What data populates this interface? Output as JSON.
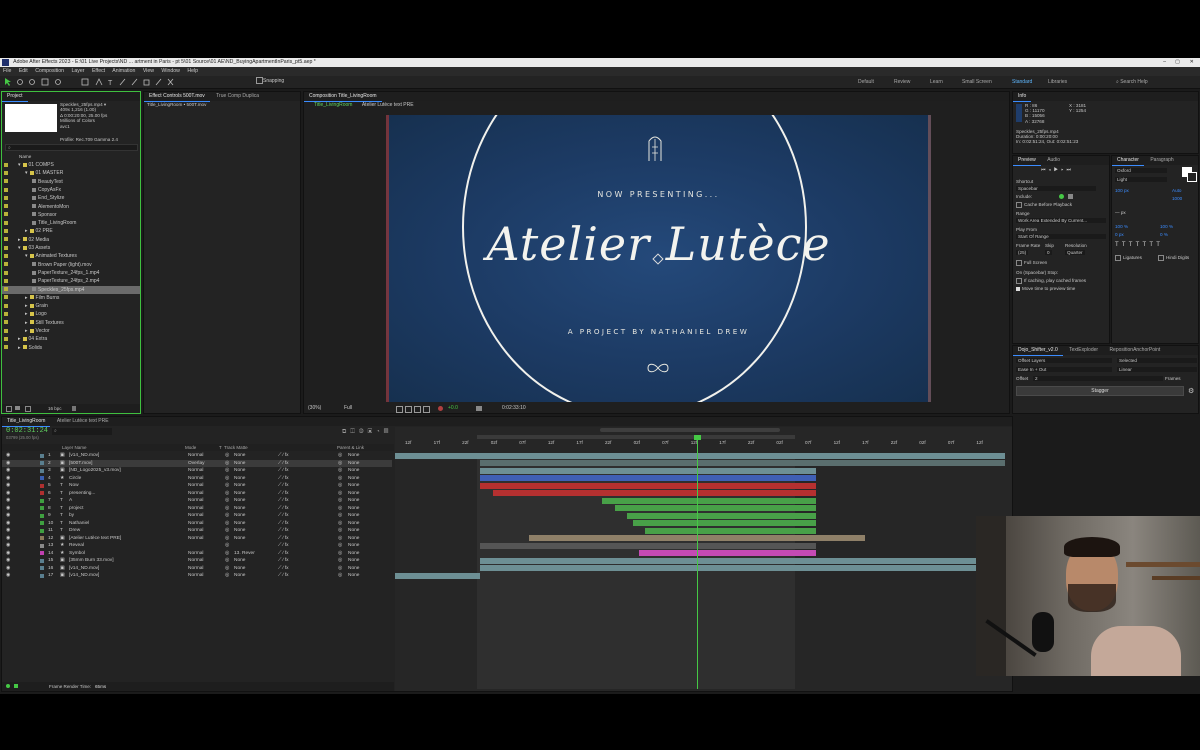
{
  "window": {
    "title": "Adobe After Effects 2023 - E:\\01 Live Projects\\ND ... artment in Paris - pt 5\\01 Source\\01 AE\\ND_BuyingApartmentInParis_pt5.aep *",
    "min": "–",
    "max": "▢",
    "close": "✕"
  },
  "menu": [
    "File",
    "Edit",
    "Composition",
    "Layer",
    "Effect",
    "Animation",
    "View",
    "Window",
    "Help"
  ],
  "toolbar": {
    "snapping_label": "Snapping",
    "workspaces": [
      "Default",
      "Review",
      "Learn",
      "Small Screen",
      "Standard",
      "Libraries"
    ],
    "active_workspace": "Standard",
    "search_placeholder": "Search Help"
  },
  "project": {
    "tab": "Project",
    "footage_info": {
      "name": "Speckles_25fps.mp4 ▾",
      "res": "409x 1,216 (1.00)",
      "duration": "Δ 0:00:20:00, 25.00 fps",
      "colors": "Millions of Colors",
      "codec": "avc1",
      "profile": "Profile: Rec.709 Gamma 2.4"
    },
    "search_placeholder": "⌕",
    "name_header": "Name",
    "tree": [
      {
        "label": "01 COMPS",
        "indent": 0,
        "color": "#d6c44a",
        "open": true
      },
      {
        "label": "01 MASTER",
        "indent": 1,
        "color": "#d6c44a",
        "open": true
      },
      {
        "label": "BeautyText",
        "indent": 2,
        "color": "#8a8a8a"
      },
      {
        "label": "CopyAsFx",
        "indent": 2,
        "color": "#8a8a8a"
      },
      {
        "label": "End_Stylize",
        "indent": 2,
        "color": "#8a8a8a"
      },
      {
        "label": "AlementoMon",
        "indent": 2,
        "color": "#8a8a8a"
      },
      {
        "label": "Sponsor",
        "indent": 2,
        "color": "#8a8a8a"
      },
      {
        "label": "Title_LivingRoom",
        "indent": 2,
        "color": "#8a8a8a"
      },
      {
        "label": "02 PRE",
        "indent": 1,
        "color": "#d6c44a"
      },
      {
        "label": "02 Media",
        "indent": 0,
        "color": "#d6c44a"
      },
      {
        "label": "03 Assets",
        "indent": 0,
        "color": "#d6c44a",
        "open": true
      },
      {
        "label": "Animated Textures",
        "indent": 1,
        "color": "#d6c44a",
        "open": true
      },
      {
        "label": "Brown Paper (light).mov",
        "indent": 2,
        "color": "#8a8a8a"
      },
      {
        "label": "PaperTexture_24fps_1.mp4",
        "indent": 2,
        "color": "#8a8a8a"
      },
      {
        "label": "PaperTexture_24fps_2.mp4",
        "indent": 2,
        "color": "#8a8a8a"
      },
      {
        "label": "Speckles_25fps.mp4",
        "indent": 2,
        "color": "#8a8a8a",
        "selected": true
      },
      {
        "label": "Film Burns",
        "indent": 1,
        "color": "#d6c44a"
      },
      {
        "label": "Grain",
        "indent": 1,
        "color": "#d6c44a"
      },
      {
        "label": "Logo",
        "indent": 1,
        "color": "#d6c44a"
      },
      {
        "label": "Still Textures",
        "indent": 1,
        "color": "#d6c44a"
      },
      {
        "label": "Vector",
        "indent": 1,
        "color": "#d6c44a"
      },
      {
        "label": "04 Extra",
        "indent": 0,
        "color": "#d6c44a"
      },
      {
        "label": "Solids",
        "indent": 0,
        "color": "#d6c44a"
      }
    ],
    "bpc": "16 bpc"
  },
  "effect_controls": {
    "tabs": [
      "Effect Controls 500T.mov",
      "True Comp Duplica"
    ],
    "subtitle": "Title_LivingRoom • 500T.mov"
  },
  "composition": {
    "tab": "Composition Title_LivingRoom",
    "sub_tabs": [
      "Title_LivingRoom",
      "Atelier Lutèce text PRE"
    ],
    "canvas": {
      "now_presenting": "NOW PRESENTING...",
      "title": "Atelier Lutèce",
      "byline": "A PROJECT BY NATHANIEL DREW"
    },
    "footer": {
      "zoom": "(30%)",
      "res": "Full",
      "exposure": "+0.0",
      "time": "0:02:33:10"
    }
  },
  "info": {
    "tab": "Info",
    "rgba": [
      "R : 86",
      "G : 11170",
      "B : 15056",
      "A : 32768"
    ],
    "xy": [
      "X : 3181",
      "Y : 1254"
    ],
    "file": "Speckles_25fps.mp4",
    "duration": "Duration: 0:00:20:00",
    "inout": "In: 0:02:51:24, Out: 0:02:51:23"
  },
  "preview": {
    "tabs": [
      "Preview",
      "Audio"
    ],
    "shortcut_label": "Shortcut",
    "shortcut_value": "Spacebar",
    "include_label": "Include:",
    "cache_label": "Cache Before Playback",
    "range_label": "Range",
    "range_value": "Work Area Extended By Current...",
    "playfrom_label": "Play From",
    "playfrom_value": "Start Of Range",
    "framerate_label": "Frame Rate",
    "skip_label": "Skip",
    "resolution_label": "Resolution",
    "framerate_value": "(25)",
    "skip_value": "0",
    "resolution_value": "Quarter",
    "fullscreen_label": "Full Screen",
    "stop_label": "On (Spacebar) Stop:",
    "stop_opt1": "If caching, play cached frames",
    "stop_opt2": "Move time to preview time"
  },
  "character": {
    "tabs": [
      "Character",
      "Paragraph"
    ],
    "font": "Oxford",
    "style": "Light",
    "size": "100 px",
    "leading": "Auto",
    "tracking": "1000",
    "kerning_label": "— px",
    "vscale": "100 %",
    "hscale": "100 %",
    "baseline": "0 px",
    "tsume": "0 %",
    "ligatures": "Ligatures",
    "hindi": "Hindi Digits"
  },
  "dojo": {
    "tabs": [
      "Dojo_Shifter_v2.0",
      "TextExploder",
      "RepositionAnchorPoint"
    ],
    "offset_layers": "Offset Layers",
    "selected": "Selected",
    "ease": "Ease In + Out",
    "linear": "Linear",
    "offset_label": "Offset",
    "offset_value": "2",
    "frames": "Frames",
    "stagger": "Stagger"
  },
  "timeline": {
    "tabs": [
      "Title_LivingRoom",
      "Atelier Lutèce text PRE"
    ],
    "timecode": "0:02:31:24",
    "timecode_sub": "03799 (25.00 fps)",
    "headers": {
      "name": "Layer Name",
      "mode": "Mode",
      "t": "T",
      "track": "Track Matte",
      "parent": "Parent & Link"
    },
    "ruler": [
      "12f",
      "17f",
      "22f",
      "02f",
      "07f",
      "12f",
      "17f",
      "22f",
      "02f",
      "07f",
      "12f",
      "17f",
      "22f",
      "02f",
      "07f",
      "12f",
      "17f",
      "22f",
      "02f",
      "07f",
      "12f"
    ],
    "layers": [
      {
        "num": "1",
        "name": "[v14_ND.mov]",
        "mode": "Normal",
        "track": "None",
        "parent": "None",
        "color": "#5a7f8f",
        "type": "▣"
      },
      {
        "num": "2",
        "name": "[500T.mov]",
        "mode": "Overlay",
        "track": "None",
        "parent": "None",
        "color": "#5a7f8f",
        "type": "▣",
        "selected": true
      },
      {
        "num": "3",
        "name": "[ND_Logo2025_v3.mov]",
        "mode": "Normal",
        "track": "None",
        "parent": "None",
        "color": "#5a7f8f",
        "type": "▣"
      },
      {
        "num": "4",
        "name": "Circle",
        "mode": "Normal",
        "track": "None",
        "parent": "None",
        "color": "#3a5fb0",
        "type": "★"
      },
      {
        "num": "5",
        "name": "Now",
        "mode": "Normal",
        "track": "None",
        "parent": "None",
        "color": "#b03030",
        "type": "T"
      },
      {
        "num": "6",
        "name": "presenting...",
        "mode": "Normal",
        "track": "None",
        "parent": "None",
        "color": "#b03030",
        "type": "T"
      },
      {
        "num": "7",
        "name": "A",
        "mode": "Normal",
        "track": "None",
        "parent": "None",
        "color": "#3fa040",
        "type": "T"
      },
      {
        "num": "8",
        "name": "project",
        "mode": "Normal",
        "track": "None",
        "parent": "None",
        "color": "#3fa040",
        "type": "T"
      },
      {
        "num": "9",
        "name": "by",
        "mode": "Normal",
        "track": "None",
        "parent": "None",
        "color": "#3fa040",
        "type": "T"
      },
      {
        "num": "10",
        "name": "Nathaniel",
        "mode": "Normal",
        "track": "None",
        "parent": "None",
        "color": "#3fa040",
        "type": "T"
      },
      {
        "num": "11",
        "name": "Drew",
        "mode": "Normal",
        "track": "None",
        "parent": "None",
        "color": "#3fa040",
        "type": "T"
      },
      {
        "num": "12",
        "name": "[Atelier Lutèce text PRE]",
        "mode": "Normal",
        "track": "None",
        "parent": "None",
        "color": "#8a7a5a",
        "type": "▣"
      },
      {
        "num": "13",
        "name": "Reveal",
        "mode": "",
        "track": "",
        "parent": "None",
        "color": "#8a8a8a",
        "type": "★"
      },
      {
        "num": "14",
        "name": "Symbol",
        "mode": "Normal",
        "track": "13. Rever",
        "parent": "None",
        "color": "#c040b0",
        "type": "★"
      },
      {
        "num": "15",
        "name": "[35mm Burn 33.mov]",
        "mode": "Normal",
        "track": "None",
        "parent": "None",
        "color": "#5a7f8f",
        "type": "▣"
      },
      {
        "num": "16",
        "name": "[v14_ND.mov]",
        "mode": "Normal",
        "track": "None",
        "parent": "None",
        "color": "#5a7f8f",
        "type": "▣"
      },
      {
        "num": "17",
        "name": "[v14_ND.mov]",
        "mode": "Normal",
        "track": "None",
        "parent": "None",
        "color": "#5a7f8f",
        "type": "▣"
      }
    ],
    "bars": [
      {
        "start": 0.0,
        "end": 1.0,
        "color": "#6d8f94"
      },
      {
        "start": 0.14,
        "end": 1.0,
        "color": "#5a6e6e"
      },
      {
        "start": 0.14,
        "end": 0.69,
        "color": "#6d8f94"
      },
      {
        "start": 0.14,
        "end": 0.69,
        "color": "#3f5fb5"
      },
      {
        "start": 0.14,
        "end": 0.69,
        "color": "#b53030"
      },
      {
        "start": 0.16,
        "end": 0.69,
        "color": "#b53030"
      },
      {
        "start": 0.34,
        "end": 0.69,
        "color": "#48a048"
      },
      {
        "start": 0.36,
        "end": 0.69,
        "color": "#48a048"
      },
      {
        "start": 0.38,
        "end": 0.69,
        "color": "#48a048"
      },
      {
        "start": 0.39,
        "end": 0.69,
        "color": "#48a048"
      },
      {
        "start": 0.41,
        "end": 0.69,
        "color": "#48a048"
      },
      {
        "start": 0.22,
        "end": 0.77,
        "color": "#8f8068"
      },
      {
        "start": 0.14,
        "end": 0.69,
        "color": "#555555"
      },
      {
        "start": 0.4,
        "end": 0.69,
        "color": "#c44ab4"
      },
      {
        "start": 0.14,
        "end": 1.0,
        "color": "#6d8f94"
      },
      {
        "start": 0.14,
        "end": 1.0,
        "color": "#6d8f94"
      },
      {
        "start": 0.0,
        "end": 0.14,
        "color": "#6d8f94"
      }
    ],
    "playhead": 0.49,
    "render_label": "Frame Render Time:",
    "render_value": "65ms"
  },
  "colors": {
    "accent": "#3b8cff",
    "playhead": "#45c845",
    "comp_bg": "#1c3a63"
  }
}
